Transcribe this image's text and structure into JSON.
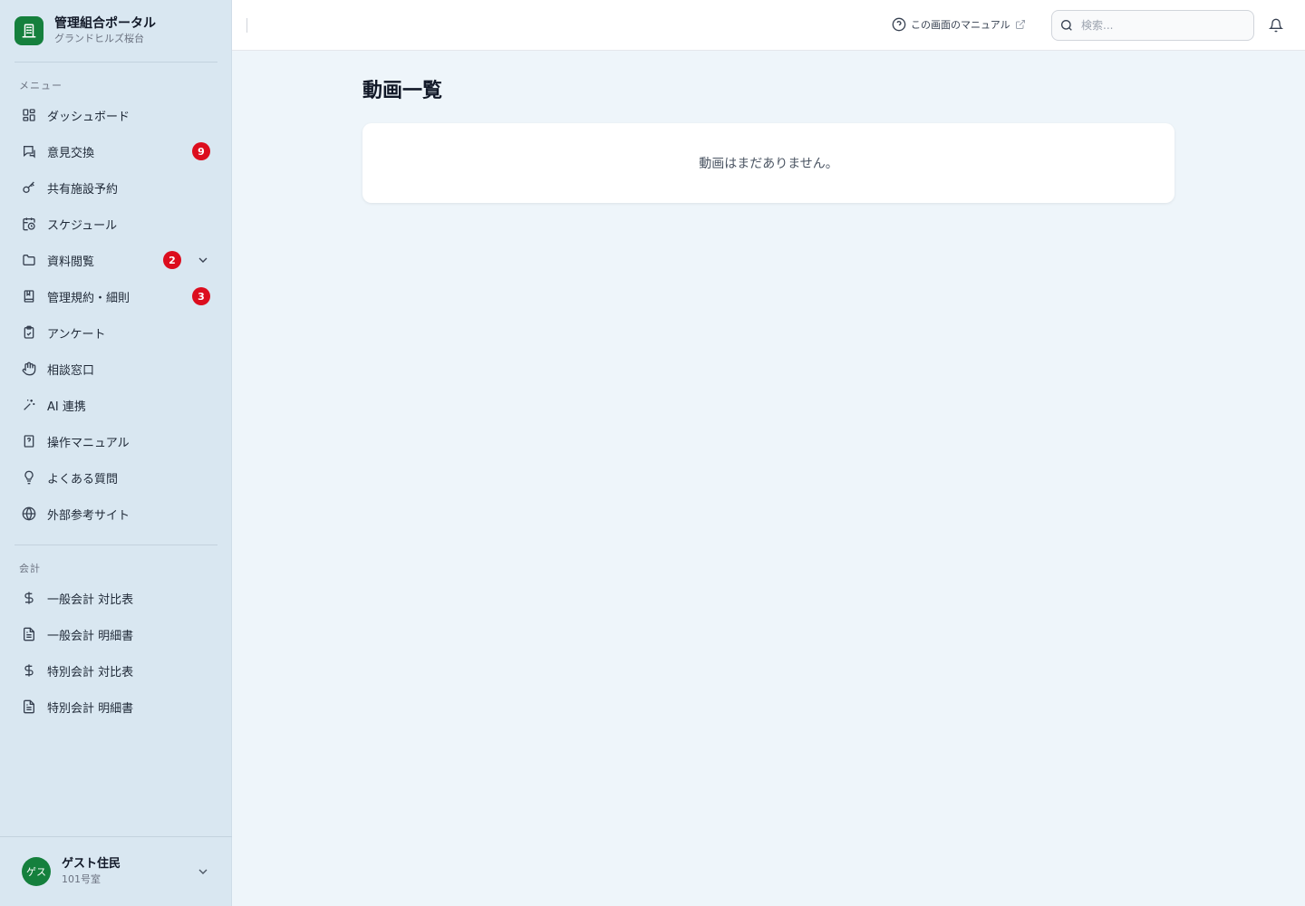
{
  "brand": {
    "title": "管理組合ポータル",
    "subtitle": "グランドヒルズ桜台"
  },
  "sections": {
    "menu": "メニュー",
    "accounting": "会計"
  },
  "menu": [
    {
      "label": "ダッシュボード",
      "icon": "dashboard-icon"
    },
    {
      "label": "意見交換",
      "icon": "chat-icon",
      "badge": "9"
    },
    {
      "label": "共有施設予約",
      "icon": "key-icon"
    },
    {
      "label": "スケジュール",
      "icon": "calendar-clock-icon"
    },
    {
      "label": "資料閲覧",
      "icon": "folder-icon",
      "badge": "2"
    },
    {
      "label": "管理規約・細則",
      "icon": "book-icon",
      "badge": "3"
    },
    {
      "label": "アンケート",
      "icon": "clipboard-check-icon"
    },
    {
      "label": "相談窓口",
      "icon": "hand-icon"
    },
    {
      "label": "AI 連携",
      "icon": "sparkles-icon"
    },
    {
      "label": "操作マニュアル",
      "icon": "manual-book-icon"
    },
    {
      "label": "よくある質問",
      "icon": "lightbulb-icon"
    },
    {
      "label": "外部参考サイト",
      "icon": "globe-icon"
    }
  ],
  "accounting": [
    {
      "label": "一般会計 対比表",
      "icon": "dollar-icon"
    },
    {
      "label": "一般会計 明細書",
      "icon": "document-icon"
    },
    {
      "label": "特別会計 対比表",
      "icon": "dollar-icon"
    },
    {
      "label": "特別会計 明細書",
      "icon": "document-icon"
    }
  ],
  "user": {
    "avatar": "ゲス",
    "name": "ゲスト住民",
    "room": "101号室"
  },
  "header": {
    "manual_link": "この画面のマニュアル",
    "search_placeholder": "検索..."
  },
  "main": {
    "title": "動画一覧",
    "empty_message": "動画はまだありません。"
  },
  "colors": {
    "accent": "#15803d",
    "badge": "#dc0d1e",
    "sidebar": "#d9e7f1",
    "background": "#eef5fa"
  }
}
